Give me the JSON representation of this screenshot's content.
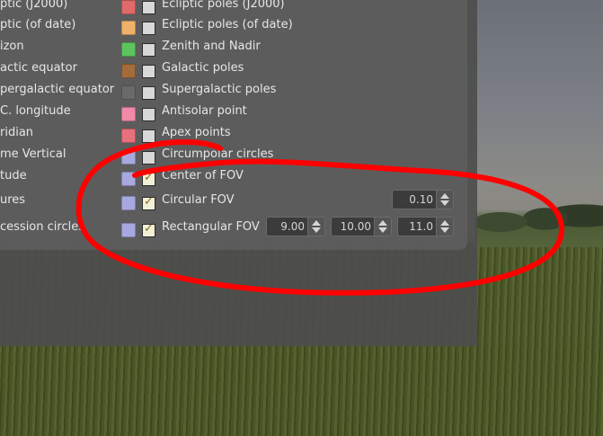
{
  "left_labels": [
    "ptic (J2000)",
    "ptic (of date)",
    "izon",
    "actic equator",
    "pergalactic equator",
    "C. longitude",
    "ridian",
    "me Vertical",
    "tude",
    "ures",
    "cession circles"
  ],
  "items": [
    {
      "label": "Ecliptic poles (J2000)",
      "color": "#e06a6a",
      "checked": false
    },
    {
      "label": "Ecliptic poles (of date)",
      "color": "#f0b26a",
      "checked": false
    },
    {
      "label": "Zenith and Nadir",
      "color": "#5cc45c",
      "checked": false
    },
    {
      "label": "Galactic poles",
      "color": "#a46c3a",
      "checked": false
    },
    {
      "label": "Supergalactic poles",
      "color": "#6a6a6a",
      "checked": false
    },
    {
      "label": "Antisolar point",
      "color": "#f08aa8",
      "checked": false
    },
    {
      "label": "Apex points",
      "color": "#e6707c",
      "checked": false
    },
    {
      "label": "Circumpolar circles",
      "color": "#a8a8e0",
      "checked": false
    },
    {
      "label": "Center of FOV",
      "color": "#a8a8e0",
      "checked": true
    },
    {
      "label": "Circular FOV",
      "color": "#a8a8e0",
      "checked": true
    },
    {
      "label": "Rectangular FOV",
      "color": "#a8a8e0",
      "checked": true
    }
  ],
  "spinboxes": {
    "circular_fov": "0.10",
    "rect_width": "9.00",
    "rect_height": "10.00",
    "rect_rotation": "11.0"
  },
  "annotation_color": "#ff0000"
}
